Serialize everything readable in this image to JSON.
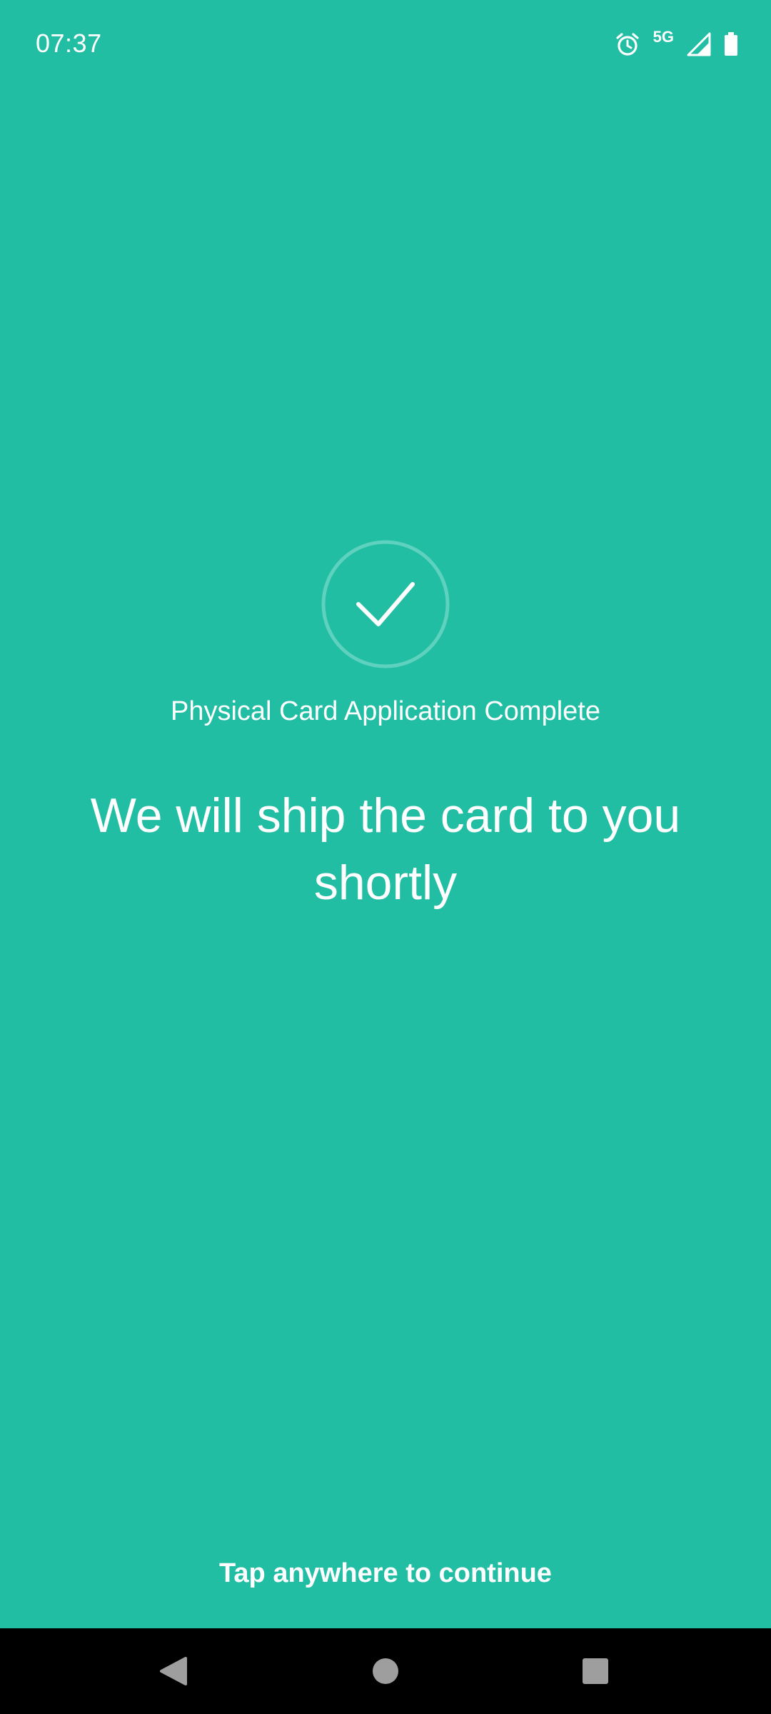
{
  "status_bar": {
    "time": "07:37",
    "network": "5G",
    "icons": [
      "alarm-icon",
      "signal-icon",
      "battery-icon"
    ]
  },
  "main": {
    "status_icon": "check-circle-icon",
    "subtitle": "Physical Card Application Complete",
    "headline": "We will ship the card to you shortly",
    "continue_hint": "Tap anywhere to continue"
  },
  "nav_bar": {
    "buttons": [
      "back-icon",
      "home-icon",
      "recents-icon"
    ]
  },
  "colors": {
    "background": "#21bea4",
    "text": "#ffffff",
    "circle_ring": "#5fd1bf",
    "nav_bar": "#000000",
    "nav_icons": "#9e9e9e"
  }
}
